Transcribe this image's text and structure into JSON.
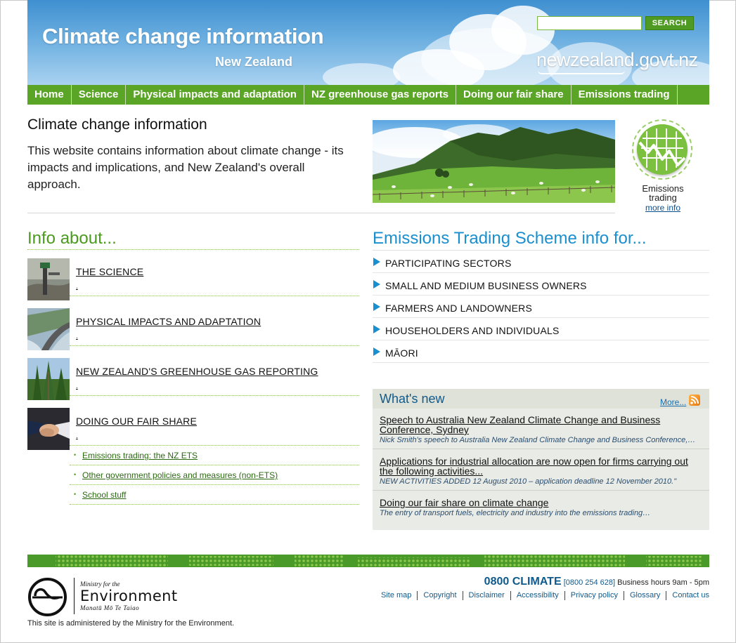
{
  "header": {
    "title": "Climate change information",
    "subtitle": "New Zealand",
    "gov_logo": "newzealand.govt.nz",
    "search": {
      "value": "",
      "button": "SEARCH"
    }
  },
  "nav": [
    {
      "label": "Home"
    },
    {
      "label": "Science"
    },
    {
      "label": "Physical impacts and adaptation"
    },
    {
      "label": "NZ greenhouse gas reports"
    },
    {
      "label": "Doing our fair share"
    },
    {
      "label": "Emissions trading"
    }
  ],
  "intro": {
    "title": "Climate change information",
    "text": "This website contains information about climate change - its impacts and implications, and New Zealand's overall approach."
  },
  "ets_promo": {
    "label_line1": "Emissions",
    "label_line2": "trading",
    "more": "more info"
  },
  "info": {
    "heading": "Info about...",
    "items": [
      {
        "label": "THE SCIENCE",
        "dot": "."
      },
      {
        "label": "PHYSICAL IMPACTS AND ADAPTATION",
        "dot": "."
      },
      {
        "label": "NEW ZEALAND'S GREENHOUSE GAS REPORTING",
        "dot": "."
      },
      {
        "label": "DOING OUR FAIR SHARE",
        "dot": "."
      }
    ],
    "sublinks": [
      {
        "bullet": "•",
        "label": "Emissions trading: the NZ ETS"
      },
      {
        "bullet": "•",
        "label": "Other government policies and measures (non-ETS)"
      },
      {
        "bullet": "•",
        "label": "School stuff"
      }
    ]
  },
  "ets_info": {
    "heading": "Emissions Trading Scheme info for...",
    "items": [
      {
        "label": "PARTICIPATING SECTORS"
      },
      {
        "label": "SMALL AND MEDIUM BUSINESS OWNERS"
      },
      {
        "label": "FARMERS AND LANDOWNERS"
      },
      {
        "label": "HOUSEHOLDERS AND INDIVIDUALS"
      },
      {
        "label": "MĀORI"
      }
    ]
  },
  "whats_new": {
    "title": "What's new",
    "more": "More...",
    "items": [
      {
        "title": "Speech to Australia New Zealand Climate Change and Business Conference, Sydney",
        "desc": "Nick Smith's speech to Australia New Zealand Climate Change and Business Conference,…"
      },
      {
        "title": "Applications for industrial allocation are now open for firms carrying out the following activities...",
        "desc": "NEW ACTIVITIES ADDED 12 August 2010 – application deadline 12 November 2010.\""
      },
      {
        "title": "Doing our fair share on climate change",
        "desc": "The entry of transport fuels, electricity and industry into the emissions trading…"
      }
    ]
  },
  "footer": {
    "ministry_small": "Ministry for the",
    "ministry_big": "Environment",
    "ministry_maori": "Manatū Mō Te Taiao",
    "admin": "This site is administered by the Ministry for the Environment.",
    "phone_big": "0800 CLIMATE",
    "phone_num": "[0800 254 628]",
    "hours": "Business hours 9am - 5pm",
    "links": [
      "Site map",
      "Copyright",
      "Disclaimer",
      "Accessibility",
      "Privacy policy",
      "Glossary",
      "Contact us"
    ]
  },
  "colors": {
    "brand_green": "#5aa426",
    "accent_blue": "#1a8fcf",
    "dark_blue": "#0f5a8c"
  }
}
